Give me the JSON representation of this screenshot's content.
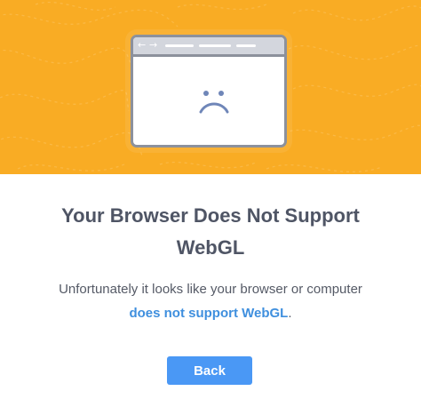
{
  "colors": {
    "hero_background": "#f9ac24",
    "title_text": "#4f5565",
    "link": "#3f8fde",
    "button_background": "#4a98f5",
    "button_text": "#ffffff"
  },
  "hero": {
    "illustration": {
      "icons": [
        "back-arrow-icon",
        "forward-arrow-icon",
        "sad-face-icon"
      ],
      "back_arrow": "←",
      "forward_arrow": "→"
    }
  },
  "title": {
    "line1": "Your Browser Does Not Support",
    "line2": "WebGL"
  },
  "message": {
    "line1": "Unfortunately it looks like your browser or computer",
    "link_text": "does not support WebGL",
    "trailing": "."
  },
  "actions": {
    "back_label": "Back"
  }
}
